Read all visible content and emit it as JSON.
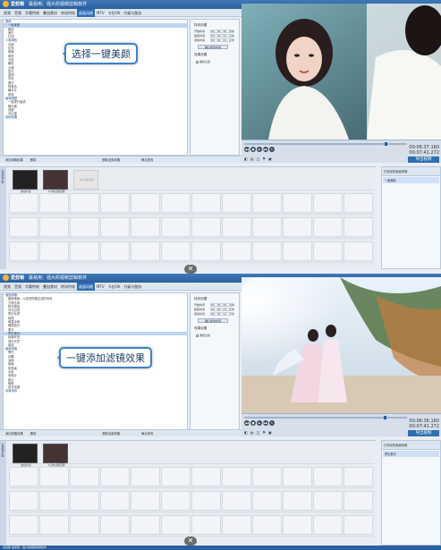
{
  "app": {
    "logo_text": "爱剪辑",
    "title_suffix": "最易用、强大的视频剪辑软件"
  },
  "menu": [
    "视频",
    "音频",
    "字幕特效",
    "叠加素材",
    "转场特效",
    "画面风格",
    "MTV",
    "卡拉OK",
    "升级与服务"
  ],
  "menu_active_index": 5,
  "panel1": {
    "callout": "选择一键美颜",
    "effects": [
      {
        "label": "美颜",
        "cat": true
      },
      {
        "label": "一键美颜",
        "sel": true
      },
      {
        "label": "磨皮"
      },
      {
        "label": "美白"
      },
      {
        "label": "红润"
      },
      {
        "label": "人像调色",
        "cat": true
      },
      {
        "label": "清新"
      },
      {
        "label": "红润"
      },
      {
        "label": "唯美"
      },
      {
        "label": "明亮"
      },
      {
        "label": "冷色"
      },
      {
        "label": "暖色"
      },
      {
        "label": "淡雅"
      },
      {
        "label": "复古"
      },
      {
        "label": "蓝调"
      },
      {
        "label": "青色"
      },
      {
        "label": "黑白"
      },
      {
        "label": "阿宝色"
      },
      {
        "label": "糖水片"
      },
      {
        "label": "质感"
      },
      {
        "label": "画面调整",
        "cat": true
      },
      {
        "label": "一键提升画质"
      },
      {
        "label": "曝光度"
      },
      {
        "label": "亮度"
      },
      {
        "label": "对比度"
      },
      {
        "label": "其他效果",
        "cat": true
      }
    ],
    "time1": "00:06:37.160",
    "time2": "00:07:41.272",
    "export": "导出视频",
    "right_header": "已添加的画面风格",
    "right_item": "一键美颜",
    "clip1_caption": "启动片段",
    "clip2_caption": "2.[梦]丝路花雨",
    "clip3_caption": "[梦]丝路花雨"
  },
  "panel2": {
    "callout": "一键添加滤镜效果",
    "effects": [
      {
        "label": "画面风格",
        "cat": true
      },
      {
        "label": "晶莹美画，以滤镜风格生成的特效",
        "cat": false
      },
      {
        "label": "万物生辉"
      },
      {
        "label": "阳光映射"
      },
      {
        "label": "月光幻境"
      },
      {
        "label": "梦幻仙境"
      },
      {
        "label": "绚丽"
      },
      {
        "label": "黄昏余晖"
      },
      {
        "label": "瑰丽霞光"
      },
      {
        "label": "柔光"
      },
      {
        "label": "梦幻柔光",
        "sel": true
      },
      {
        "label": "经典怀旧"
      },
      {
        "label": "强光写意"
      },
      {
        "label": "素描"
      },
      {
        "label": "画面风格",
        "cat": true
      },
      {
        "label": "黑白"
      },
      {
        "label": "浮雕"
      },
      {
        "label": "油画"
      },
      {
        "label": "版画"
      },
      {
        "label": "铅笔画"
      },
      {
        "label": "水彩"
      },
      {
        "label": "老照片"
      },
      {
        "label": "胶片"
      },
      {
        "label": "暗角"
      },
      {
        "label": "炫光效果"
      },
      {
        "label": "动景特效",
        "cat": true
      }
    ],
    "time1": "00:06:36.160",
    "time2": "00:07:41.272",
    "export": "导出视频",
    "right_header": "已添加的画面风格",
    "right_item": "梦幻柔光",
    "clip1_caption": "启动片段",
    "clip2_caption": "2.[梦]丝路花雨"
  },
  "settings": {
    "section1": "特效设置",
    "start_label": "开始时间",
    "start_val": "00 : 00 : 00 . 000",
    "end_label": "结束时间",
    "end_val": "00 : 00 : 01 . 272",
    "dur_label": "持续时间",
    "dur_val": "00 : 00 : 01 . 272",
    "button": "确认修改时间",
    "section2": "效果设置",
    "checkbox": "柔和过渡"
  },
  "editbar": {
    "add_effect": "添加风格效果",
    "delete": "删除",
    "delete_all": "删除全部风格",
    "confirm": "确认修改"
  },
  "timeline_label": "已添加片段",
  "status": "爱剪辑    最易用、强大的视频剪辑软件",
  "scroll_symbol": "✕",
  "tools": [
    "◧",
    "▤",
    "◫",
    "⚑",
    "▣"
  ],
  "play_buttons": [
    "◀◀",
    "■",
    "▶",
    "▶▶",
    "↻"
  ],
  "colors": {
    "accent": "#2d6eb4",
    "selection": "#bcd6f3"
  }
}
